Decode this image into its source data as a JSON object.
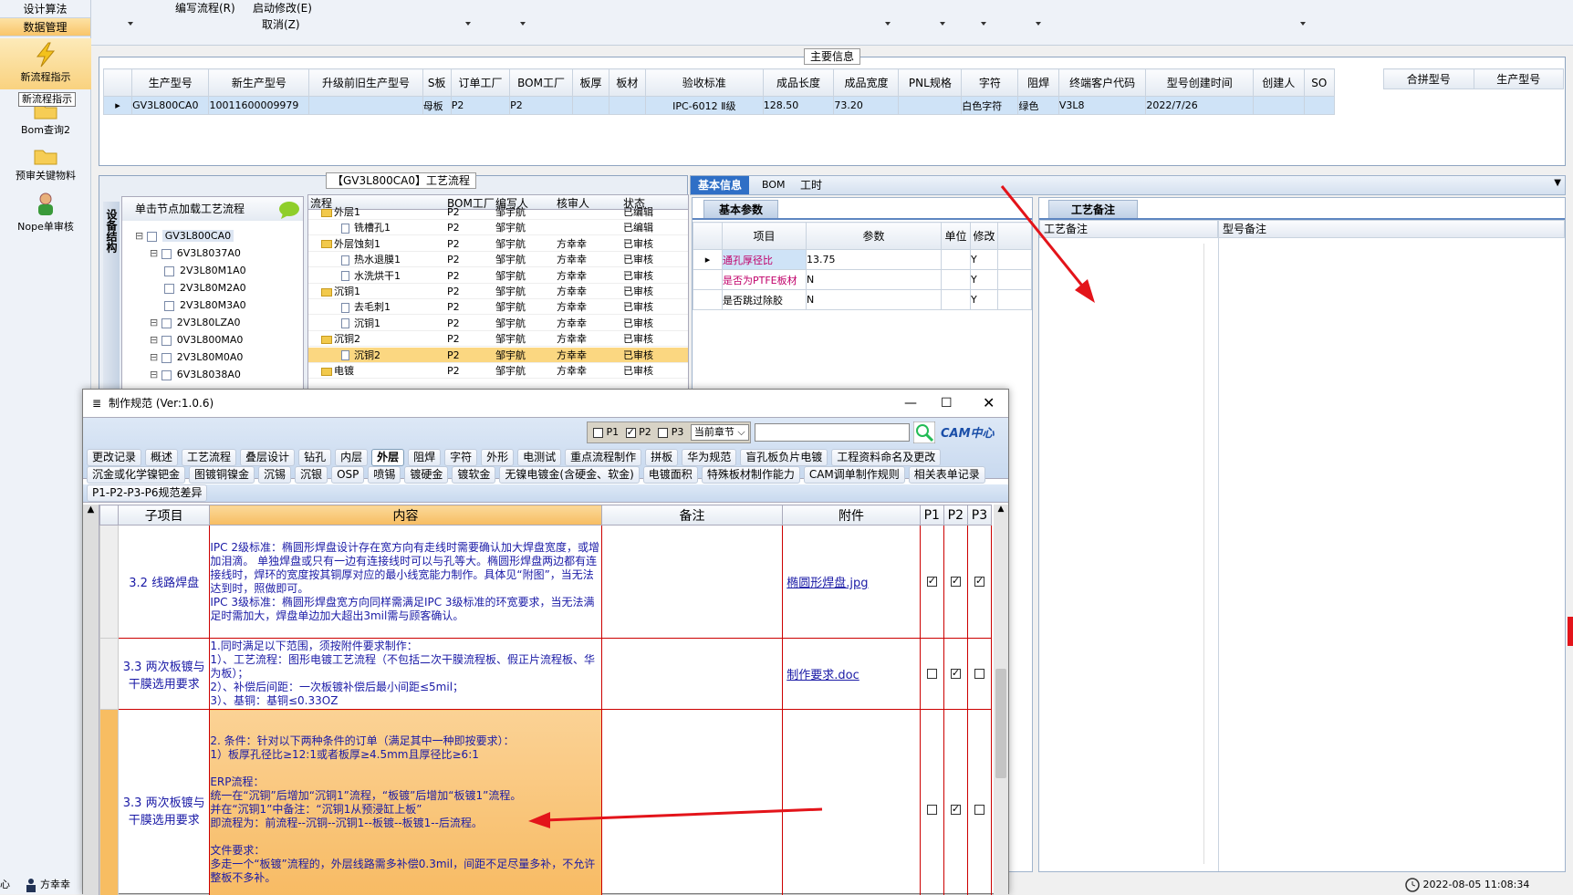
{
  "sidebar": {
    "categories": [
      "设计算法",
      "数据管理"
    ],
    "items": [
      {
        "label": "新流程指示",
        "icon": "lightning-icon"
      },
      {
        "label": "Bom查询2",
        "icon": "folder-icon"
      },
      {
        "label": "预审关键物料",
        "icon": "folder-icon"
      },
      {
        "label": "Nope单审核",
        "icon": "user-icon"
      }
    ],
    "tooltip": "新流程指示",
    "footer_left": "心",
    "footer_user": "方幸幸"
  },
  "toolbar": {
    "edit_flow": "编写流程(R)",
    "start_modify": "启动修改(E)",
    "cancel": "取消(Z)"
  },
  "main_info": {
    "title": "主要信息",
    "columns": [
      "生产型号",
      "新生产型号",
      "升级前旧生产型号",
      "S板",
      "订单工厂",
      "BOM工厂",
      "板厚",
      "板材",
      "验收标准",
      "成品长度",
      "成品宽度",
      "PNL规格",
      "字符",
      "阻焊",
      "终端客户代码",
      "型号创建时间",
      "创建人",
      "SO"
    ],
    "row": [
      "GV3L800CA0",
      "10011600009979",
      "",
      "母板",
      "P2",
      "P2",
      "",
      "",
      "IPC-6012 Ⅱ级",
      "128.50",
      "73.20",
      "",
      "白色字符",
      "绿色",
      "V3L8",
      "2022/7/26",
      "",
      ""
    ],
    "side_columns": [
      "合拼型号",
      "生产型号"
    ]
  },
  "process_panel": {
    "title": "【GV3L800CA0】工艺流程",
    "side_tab": "设备结构",
    "load_hint": "单击节点加载工艺流程",
    "tree": [
      {
        "label": "GV3L800CA0",
        "level": 0
      },
      {
        "label": "6V3L8037A0",
        "level": 1
      },
      {
        "label": "2V3L80M1A0",
        "level": 2
      },
      {
        "label": "2V3L80M2A0",
        "level": 2
      },
      {
        "label": "2V3L80M3A0",
        "level": 2
      },
      {
        "label": "2V3L80LZA0",
        "level": 1
      },
      {
        "label": "0V3L800MA0",
        "level": 1
      },
      {
        "label": "2V3L80M0A0",
        "level": 1
      },
      {
        "label": "6V3L8038A0",
        "level": 1
      }
    ],
    "columns": [
      "流程",
      "BOM工厂",
      "编写人",
      "核审人",
      "状态"
    ],
    "rows": [
      {
        "name": "外层1",
        "level": 0,
        "factory": "P2",
        "writer": "邹宇航",
        "reviewer": "",
        "status": "已编辑"
      },
      {
        "name": "铣槽孔1",
        "level": 1,
        "factory": "P2",
        "writer": "邹宇航",
        "reviewer": "",
        "status": "已编辑"
      },
      {
        "name": "外层蚀刻1",
        "level": 0,
        "factory": "P2",
        "writer": "邹宇航",
        "reviewer": "方幸幸",
        "status": "已审核"
      },
      {
        "name": "热水退膜1",
        "level": 1,
        "factory": "P2",
        "writer": "邹宇航",
        "reviewer": "方幸幸",
        "status": "已审核"
      },
      {
        "name": "水洗烘干1",
        "level": 1,
        "factory": "P2",
        "writer": "邹宇航",
        "reviewer": "方幸幸",
        "status": "已审核"
      },
      {
        "name": "沉铜1",
        "level": 0,
        "factory": "P2",
        "writer": "邹宇航",
        "reviewer": "方幸幸",
        "status": "已审核"
      },
      {
        "name": "去毛刺1",
        "level": 1,
        "factory": "P2",
        "writer": "邹宇航",
        "reviewer": "方幸幸",
        "status": "已审核"
      },
      {
        "name": "沉铜1",
        "level": 1,
        "factory": "P2",
        "writer": "邹宇航",
        "reviewer": "方幸幸",
        "status": "已审核"
      },
      {
        "name": "沉铜2",
        "level": 0,
        "factory": "P2",
        "writer": "邹宇航",
        "reviewer": "方幸幸",
        "status": "已审核"
      },
      {
        "name": "沉铜2",
        "level": 1,
        "factory": "P2",
        "writer": "邹宇航",
        "reviewer": "方幸幸",
        "status": "已审核",
        "selected": true
      },
      {
        "name": "电镀",
        "level": 0,
        "factory": "P2",
        "writer": "邹宇航",
        "reviewer": "方幸幸",
        "status": "已审核"
      }
    ]
  },
  "right_tabs": [
    "基本信息",
    "BOM",
    "工时"
  ],
  "params": {
    "tab": "基本参数",
    "columns": [
      "项目",
      "参数",
      "单位",
      "修改"
    ],
    "rows": [
      {
        "item": "通孔厚径比",
        "value": "13.75",
        "unit": "",
        "mod": "Y"
      },
      {
        "item": "是否为PTFE板材",
        "value": "N",
        "unit": "",
        "mod": "Y"
      },
      {
        "item": "是否跳过除胶",
        "value": "N",
        "unit": "",
        "mod": "Y"
      }
    ]
  },
  "notes": {
    "tab": "工艺备注",
    "col1": "工艺备注",
    "col2": "型号备注"
  },
  "status_bar": {
    "datetime": "2022-08-05 11:08:34"
  },
  "dialog": {
    "title": "制作规范 (Ver:1.0.6)",
    "filters": {
      "p1": "P1",
      "p2": "P2",
      "p3": "P3",
      "chapter": "当前章节",
      "search_placeholder": ""
    },
    "logo": "CAM中心",
    "tags_row1": [
      "更改记录",
      "概述",
      "工艺流程",
      "叠层设计",
      "钻孔",
      "内层",
      "外层",
      "阻焊",
      "字符",
      "外形",
      "电测试",
      "重点流程制作",
      "拼板",
      "华为规范",
      "盲孔板负片电镀",
      "工程资料命名及更改"
    ],
    "tags_row2": [
      "沉金或化学镍钯金",
      "图镀铜镍金",
      "沉锡",
      "沉银",
      "OSP",
      "喷锡",
      "镀硬金",
      "镀软金",
      "无镍电镀金(含硬金、软金)",
      "电镀面积",
      "特殊板材制作能力",
      "CAM调单制作规则",
      "相关表单记录"
    ],
    "tags_row3": [
      "P1-P2-P3-P6规范差异"
    ],
    "selected_tag": "外层",
    "columns": [
      "子项目",
      "内容",
      "备注",
      "附件",
      "P1",
      "P2",
      "P3"
    ],
    "rows": [
      {
        "sub": "3.2 线路焊盘",
        "content": "IPC 2级标准：椭圆形焊盘设计存在宽方向有走线时需要确认加大焊盘宽度，或增加泪滴。 单独焊盘或只有一边有连接线时可以与孔等大。椭圆形焊盘两边都有连接线时，焊环的宽度按其铜厚对应的最小线宽能力制作。具体见“附图”，当无法达到时，照做即可。\nIPC 3级标准：椭圆形焊盘宽方向同样需满足IPC 3级标准的环宽要求，当无法满足时需加大，焊盘单边加大超出3mil需与顾客确认。",
        "note": "",
        "attach": "椭圆形焊盘.jpg",
        "p1": true,
        "p2": true,
        "p3": true
      },
      {
        "sub": "3.3 两次板镀与干膜选用要求",
        "content": "1.同时满足以下范围，须按附件要求制作：\n1）、工艺流程：图形电镀工艺流程（不包括二次干膜流程板、假正片流程板、华为板）；\n2）、补偿后间距：一次板镀补偿后最小间距≤5mil；\n3）、基铜：基铜≤0.33OZ",
        "note": "",
        "attach": "制作要求.doc",
        "p1": false,
        "p2": true,
        "p3": false
      },
      {
        "sub": "3.3 两次板镀与干膜选用要求",
        "content": "2. 条件：针对以下两种条件的订单（满足其中一种即按要求）：\n1）板厚孔径比≥12:1或者板厚≥4.5mm且厚径比≥6:1\n\nERP流程：\n统一在“沉铜”后增加“沉铜1”流程，“板镀”后增加“板镀1”流程。\n并在“沉铜1”中备注：“沉铜1从预浸缸上板”\n即流程为：前流程--沉铜--沉铜1--板镀--板镀1--后流程。\n\n文件要求：\n多走一个“板镀”流程的，外层线路需多补偿0.3mil，间距不足尽量多补，不允许整板不多补。",
        "note": "",
        "attach": "",
        "p1": false,
        "p2": true,
        "p3": false
      }
    ]
  }
}
